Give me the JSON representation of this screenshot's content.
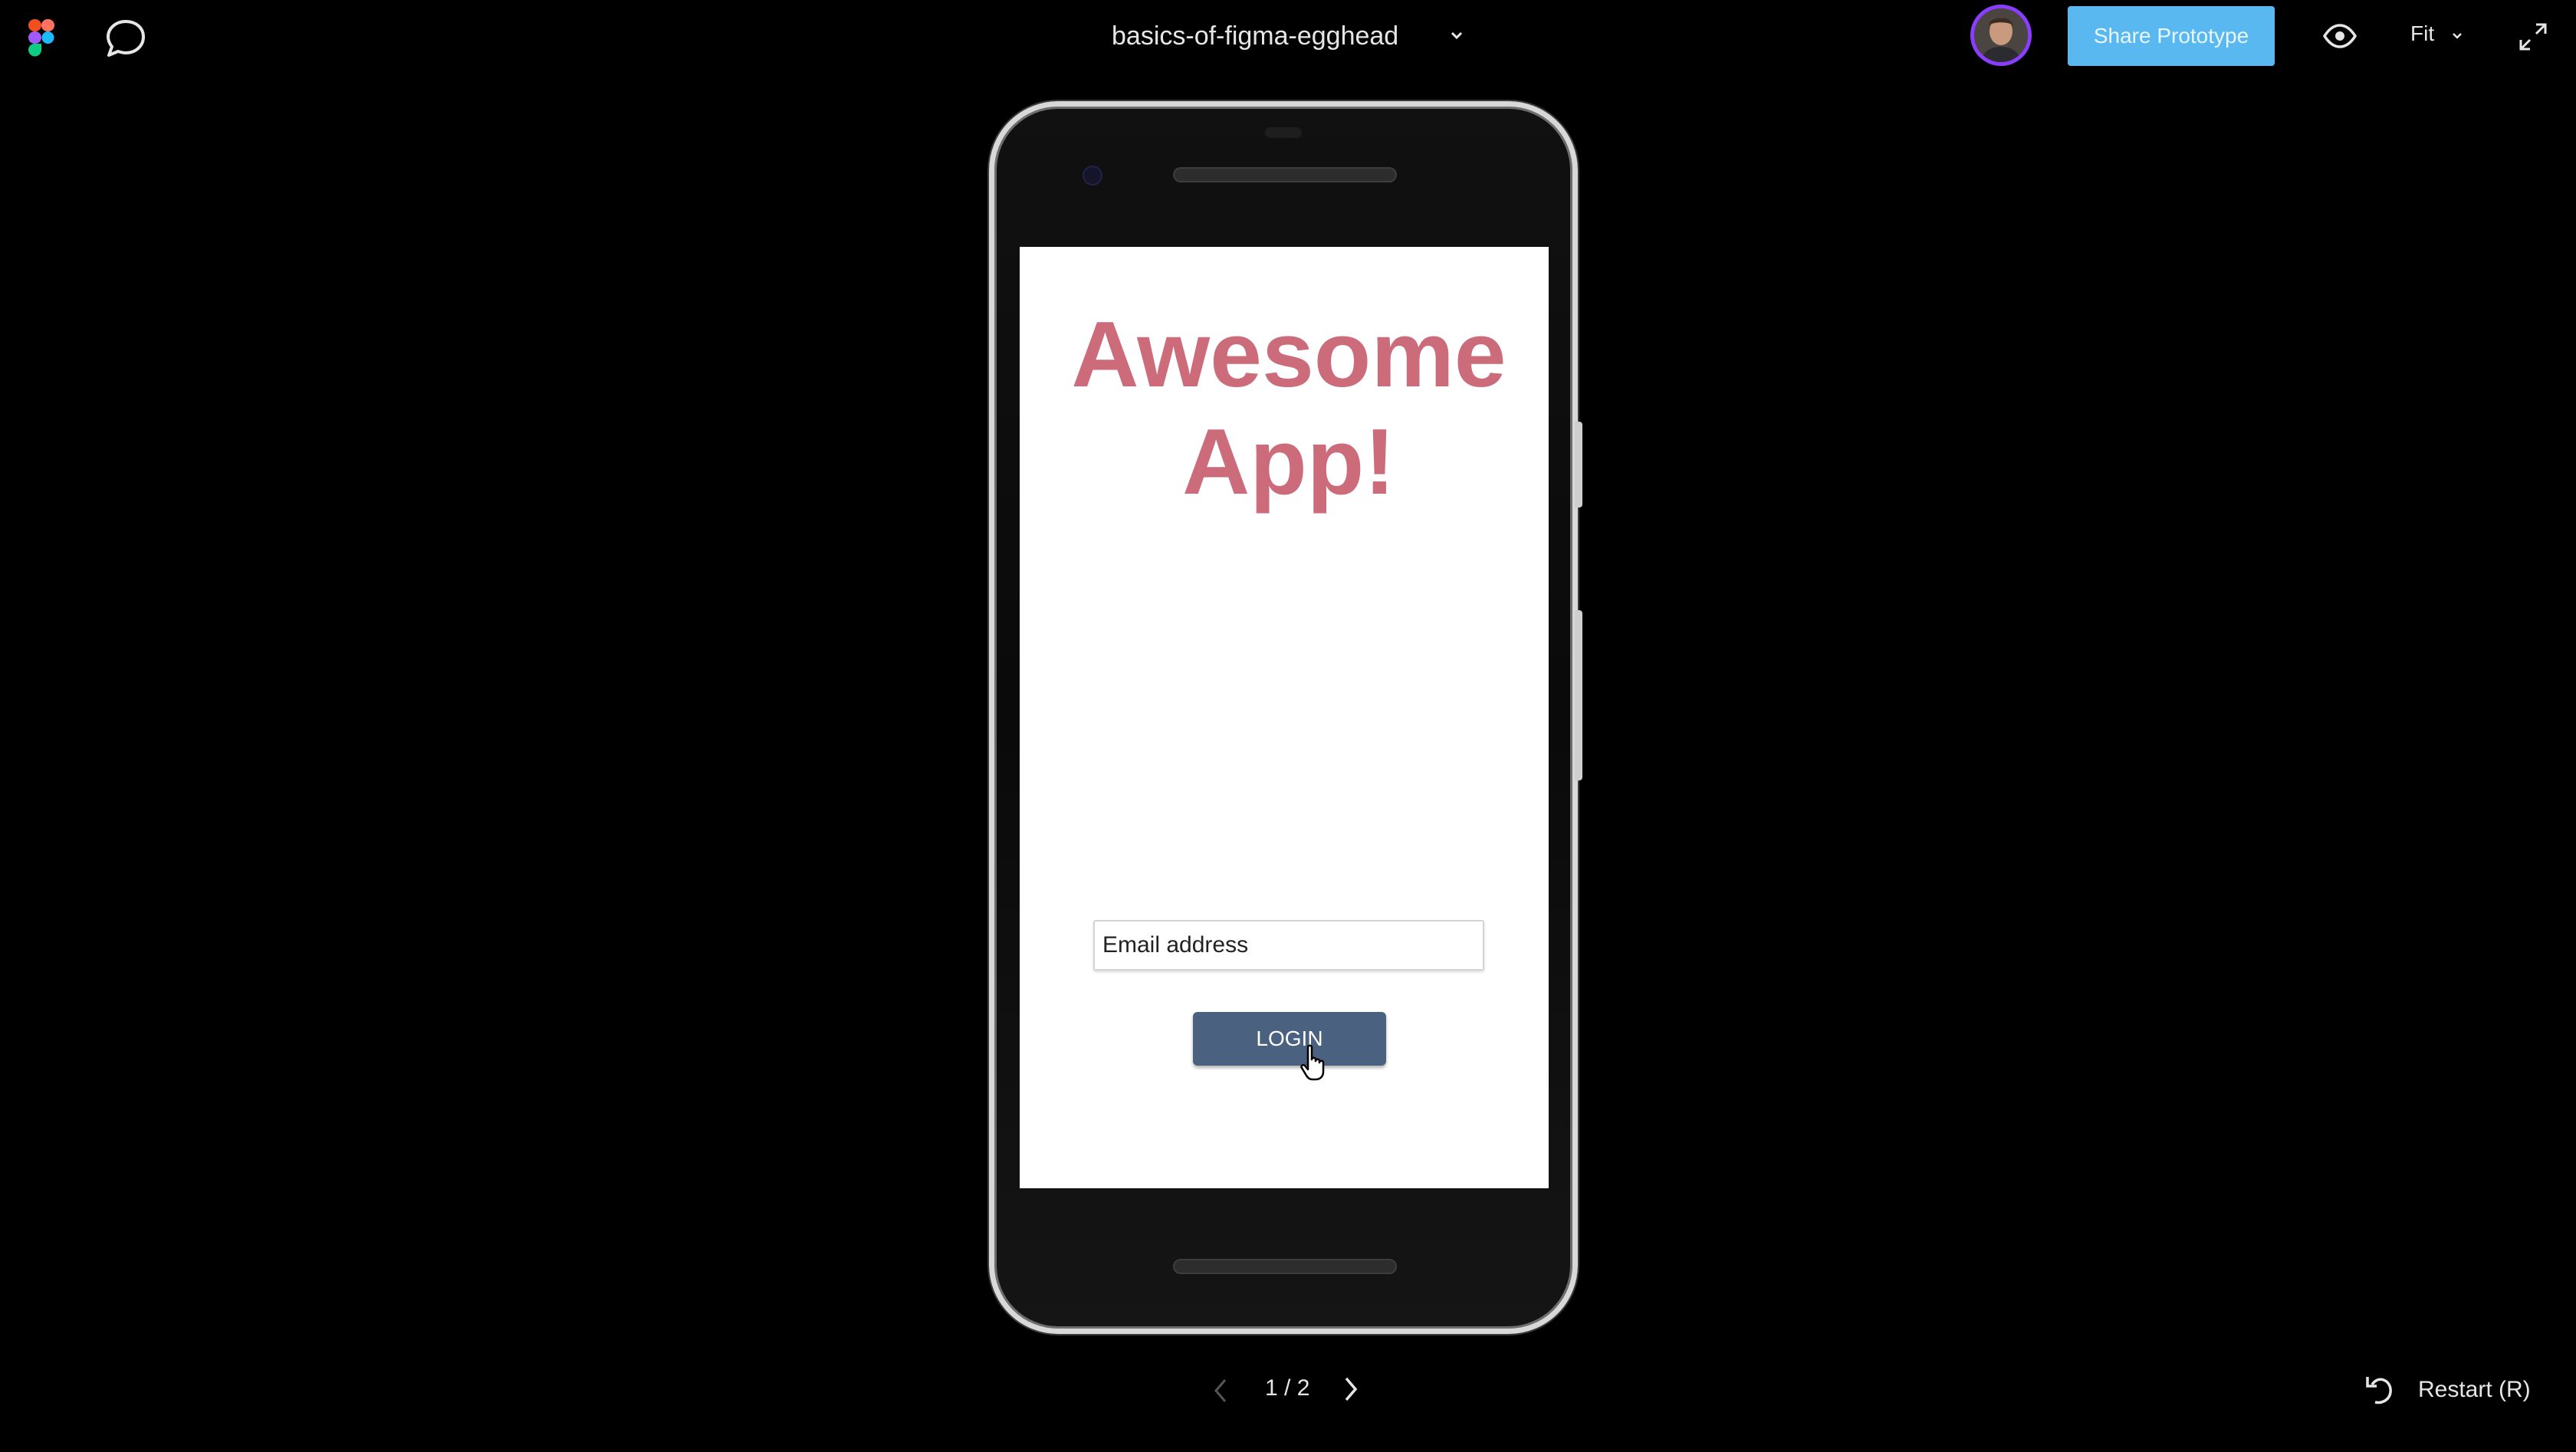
{
  "toolbar": {
    "logo_icon": "figma-logo-icon",
    "comment_icon": "comment-bubble-icon",
    "file_title": "basics-of-figma-egghead",
    "avatar_icon": "user-avatar",
    "share_label": "Share Prototype",
    "eye_icon": "eye-icon",
    "zoom_label": "Fit",
    "expand_icon": "expand-icon"
  },
  "prototype": {
    "app_title_line1": "Awesome",
    "app_title_line2": "App!",
    "email_placeholder": "Email address",
    "login_label": "LOGIN"
  },
  "footer": {
    "page_counter": "1 / 2",
    "restart_label": "Restart (R)"
  },
  "colors": {
    "share_button": "#5ab8f0",
    "title_pink": "#cc6b7a",
    "login_button": "#4a6280",
    "avatar_ring": "#8b3dff"
  }
}
